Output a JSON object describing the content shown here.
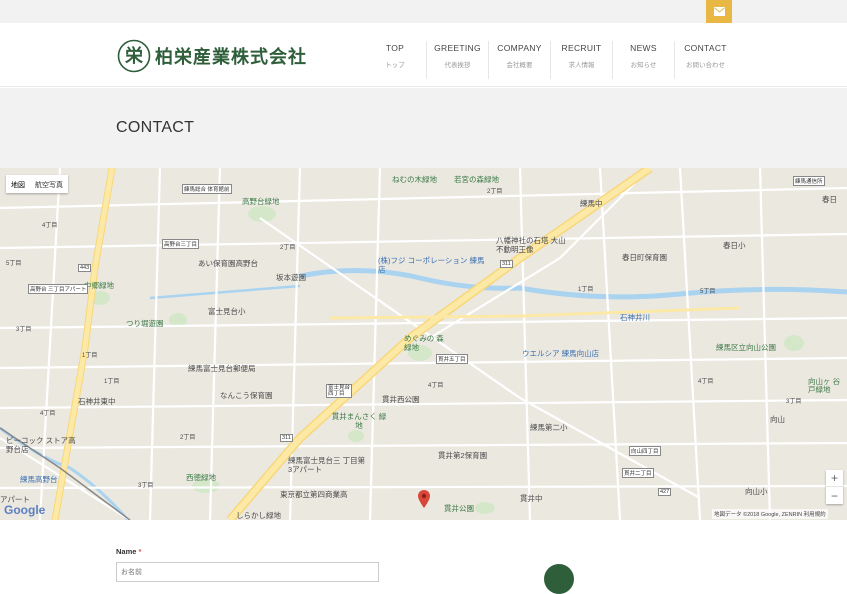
{
  "brand": {
    "logo_char": "栄",
    "name": "柏栄産業株式会社",
    "color": "#2f5e3a",
    "accent": "#e9b844"
  },
  "topbar": {
    "mail_icon": "mail-icon"
  },
  "nav": [
    {
      "en": "TOP",
      "jp": "トップ"
    },
    {
      "en": "GREETING",
      "jp": "代表挨拶"
    },
    {
      "en": "COMPANY",
      "jp": "会社概要"
    },
    {
      "en": "RECRUIT",
      "jp": "求人情報"
    },
    {
      "en": "NEWS",
      "jp": "お知らせ"
    },
    {
      "en": "CONTACT",
      "jp": "お問い合わせ"
    }
  ],
  "page": {
    "title": "CONTACT"
  },
  "map": {
    "type_map": "地図",
    "type_sat": "航空写真",
    "zoom_in": "+",
    "zoom_out": "−",
    "google": "Google",
    "attribution": "地図データ ©2018 Google, ZENRIN   利用規約",
    "labels": [
      "ねむの木緑地",
      "若宮の森緑地",
      "2丁目",
      "練馬中",
      "練馬通信所",
      "高野台緑地",
      "練馬総合 体育館前",
      "高野台三丁目",
      "あい保育園高野台",
      "坂本遊園",
      "(株)フジ コーポレーション 練馬店",
      "八幡神社の石塔 大山不動明王像",
      "春日町保育園",
      "春日小",
      "1丁目",
      "5丁目",
      "石神井川",
      "中郷緑地",
      "つり堀遊園",
      "富士見台小",
      "めぐみの 森緑地",
      "貫井五丁目",
      "ウエルシア 練馬向山店",
      "練馬区立向山公園",
      "練馬富士見台郵便局",
      "なんこう保育園",
      "富士見台 西丁目",
      "貫井西公園",
      "4丁目",
      "練馬第二小",
      "貫井まんさく 緑地",
      "石神井東中",
      "貫井第2保育園",
      "向山四丁目",
      "貫井二丁目",
      "ビーコック ストア高野台店",
      "練馬高野台",
      "西徳緑地",
      "練馬富士見台三 丁目第3アパート",
      "東京都立第四商業高",
      "貫井中",
      "貫井公園",
      "しらかし緑地",
      "向山小",
      "向山",
      "高野台 三丁目アパート",
      "3丁目",
      "4丁目",
      "1丁目",
      "2丁目",
      "4丁目",
      "1丁目",
      "3丁目",
      "3丁目",
      "4丁目",
      "2丁目",
      "5丁目",
      "春日",
      "向山ヶ 谷戸緑地",
      "アパート"
    ],
    "road_labels": [
      "443",
      "311",
      "311",
      "427"
    ]
  },
  "form": {
    "name_label": "Name",
    "required_mark": "*",
    "name_placeholder": "お名前"
  }
}
